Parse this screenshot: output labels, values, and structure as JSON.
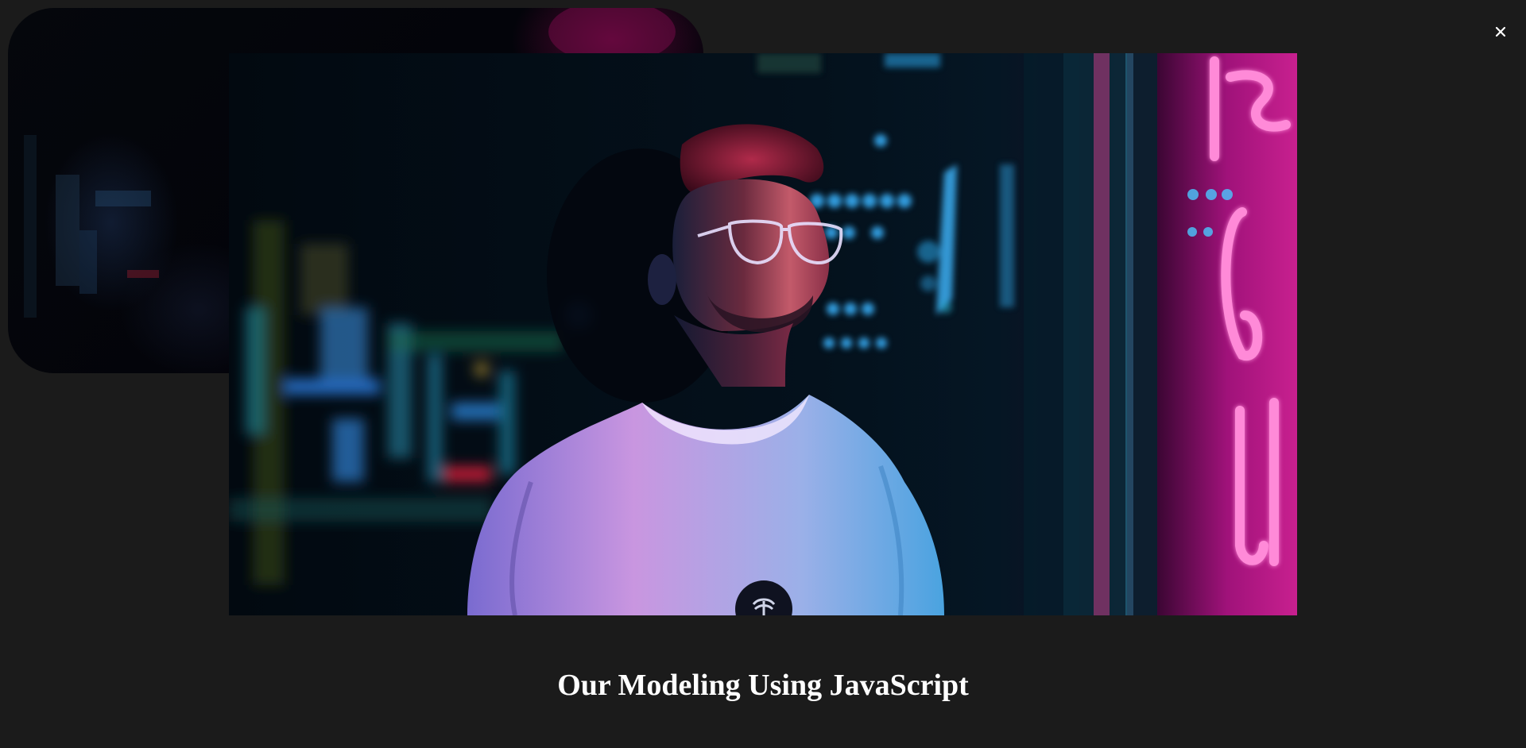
{
  "lightbox": {
    "caption": "Our Modeling Using JavaScript",
    "close_icon": "close-icon",
    "photo_subject": "portrait-photo"
  },
  "background": {
    "card_icon": "photo-card"
  },
  "colors": {
    "page_background": "#1b1b1b",
    "caption_text": "#ffffff",
    "neon_pink": "#ff3fb4",
    "neon_cyan": "#2ea8ff"
  }
}
